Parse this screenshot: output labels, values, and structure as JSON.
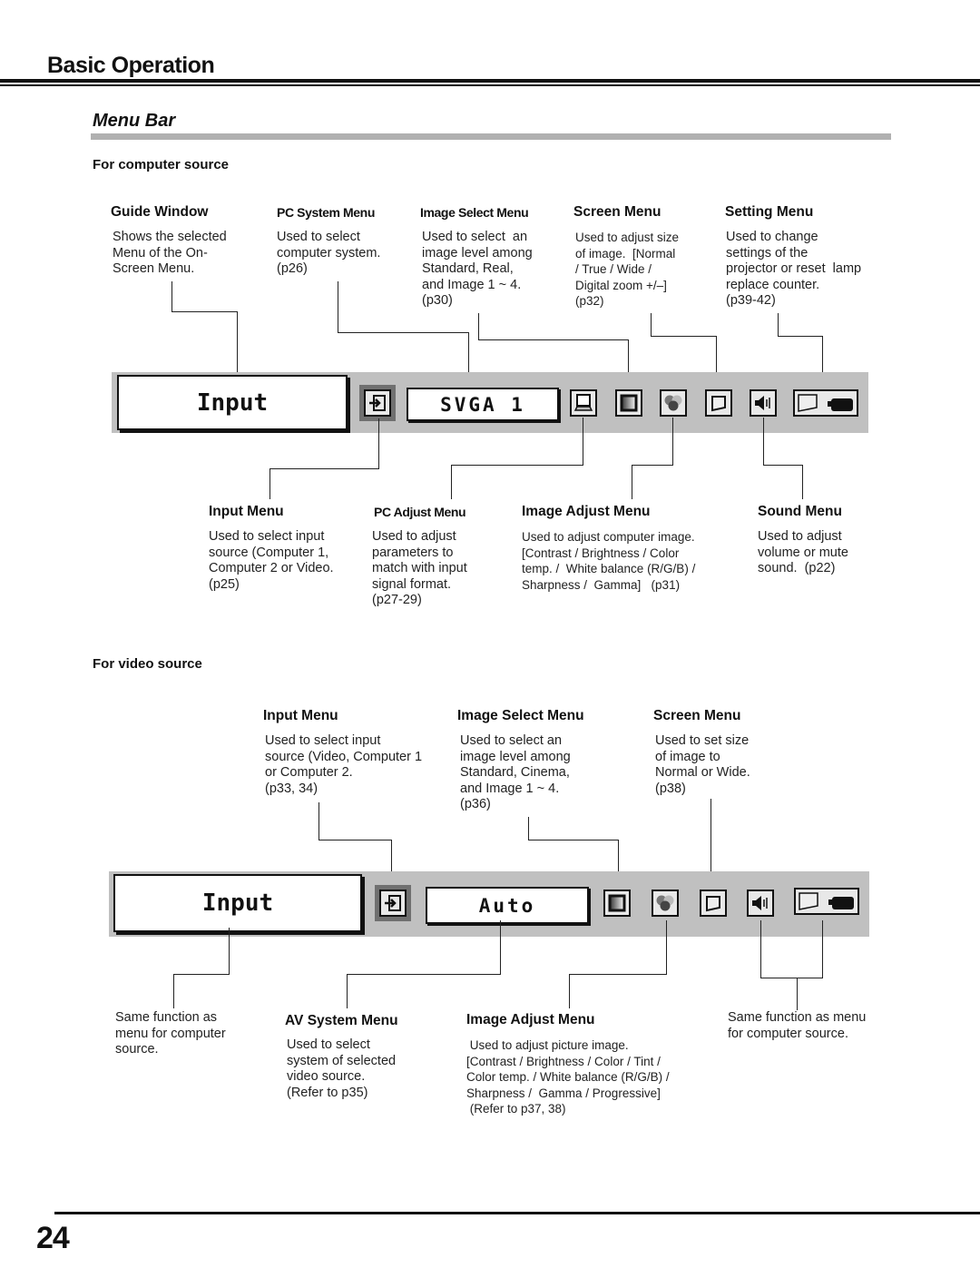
{
  "header": {
    "section": "Basic Operation",
    "title": "Menu Bar"
  },
  "computer": {
    "subhead": "For computer source",
    "guide_text": "Input",
    "system_text": "SVGA 1",
    "top": [
      {
        "label": "Guide Window",
        "desc": "Shows the selected\nMenu of the On-\nScreen Menu."
      },
      {
        "label": "PC System Menu",
        "desc": "Used to select\ncomputer system.\n(p26)"
      },
      {
        "label": "Image Select Menu",
        "desc": "Used to select  an\nimage level among\nStandard, Real,\nand Image 1 ~ 4.\n(p30)"
      },
      {
        "label": "Screen Menu",
        "desc": "Used to adjust size\nof image.  [Normal\n/ True / Wide /\nDigital zoom +/–]\n(p32)"
      },
      {
        "label": "Setting Menu",
        "desc": "Used to change\nsettings of the\nprojector or reset  lamp\nreplace counter.\n(p39-42)"
      }
    ],
    "bottom": [
      {
        "label": "Input Menu",
        "desc": "Used to select input\nsource (Computer 1,\nComputer 2 or Video.\n(p25)"
      },
      {
        "label": "PC Adjust Menu",
        "desc": "Used to adjust\nparameters to\nmatch with input\nsignal format.\n(p27-29)"
      },
      {
        "label": "Image Adjust Menu",
        "desc": "Used to adjust computer image.\n[Contrast / Brightness / Color\ntemp. /  White balance (R/G/B) /\nSharpness /  Gamma]   (p31)"
      },
      {
        "label": "Sound Menu",
        "desc": "Used to adjust\nvolume or mute\nsound.  (p22)"
      }
    ]
  },
  "video": {
    "subhead": "For video source",
    "guide_text": "Input",
    "system_text": "Auto",
    "top": [
      {
        "label": "Input Menu",
        "desc": "Used to select input\nsource (Video, Computer 1\nor Computer 2.\n(p33, 34)"
      },
      {
        "label": "Image Select Menu",
        "desc": "Used to select an\nimage level among\nStandard, Cinema,\nand Image 1 ~ 4.\n(p36)"
      },
      {
        "label": "Screen Menu",
        "desc": "Used to set size\nof image to\nNormal or Wide.\n(p38)"
      }
    ],
    "bottom": [
      {
        "label": "",
        "desc": "Same function as\nmenu for computer\nsource."
      },
      {
        "label": "AV System Menu",
        "desc": "Used to select\nsystem of selected\nvideo source.\n(Refer to p35)"
      },
      {
        "label": "Image Adjust Menu",
        "desc": " Used to adjust picture image.\n[Contrast / Brightness / Color / Tint /\nColor temp. / White balance (R/G/B) /\nSharpness /  Gamma / Progressive]\n (Refer to p37, 38)"
      },
      {
        "label": "",
        "desc": "Same function as menu\nfor computer source."
      }
    ]
  },
  "icons": [
    "input-icon",
    "pc-adjust-icon",
    "image-select-icon",
    "image-adjust-icon",
    "screen-icon",
    "sound-icon",
    "setting-icon"
  ],
  "footer": {
    "page_number": "24"
  }
}
